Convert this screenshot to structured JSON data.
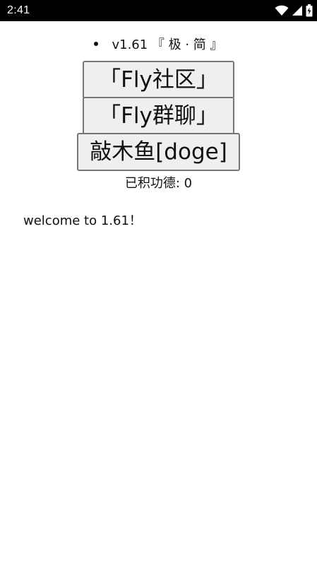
{
  "status_bar": {
    "time": "2:41",
    "icons": [
      "wifi-icon",
      "signal-icon",
      "battery-charging-icon"
    ]
  },
  "main": {
    "version_text": "v1.61 『 极 · 简 』",
    "buttons": {
      "community": "「Fly社区」",
      "group_chat": "「Fly群聊」",
      "wooden_fish": "敲木鱼[doge]"
    },
    "merit": {
      "label": "已积功德: ",
      "count": "0"
    },
    "welcome": "welcome to 1.61！"
  }
}
